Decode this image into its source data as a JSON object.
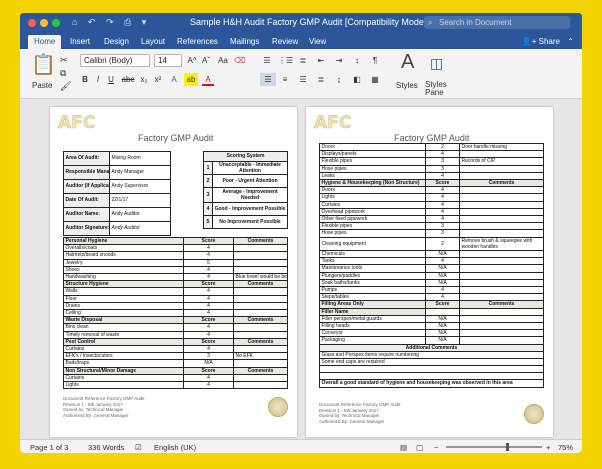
{
  "window": {
    "title": "Sample H&H Audit Factory GMP Audit [Compatibility Mode]",
    "search_placeholder": "Search in Document",
    "quick_access": "⌂ ↶ ↷ ⎙ ▾"
  },
  "tabs": [
    "Home",
    "Insert",
    "Design",
    "Layout",
    "References",
    "Mailings",
    "Review",
    "View"
  ],
  "share_label": "Share",
  "ribbon": {
    "paste": "Paste",
    "font": "Calibri (Body)",
    "size": "14",
    "styles": "Styles",
    "styles_pane": "Styles Pane",
    "bold": "B",
    "italic": "I",
    "underline": "U",
    "strike": "abc",
    "sub": "x₂",
    "sup": "x²",
    "grow": "A^",
    "shrink": "Aˇ",
    "aa": "Aa",
    "font_color": "A",
    "highlight": "ab"
  },
  "page1": {
    "logo": "AFC",
    "title": "Factory GMP Audit",
    "info": [
      [
        "Area Of Audit:",
        "Mixing Room"
      ],
      [
        "Responsible Manager:",
        "Andy Manager"
      ],
      [
        "Auditor (If Applicable):",
        "Andy Supervisor"
      ],
      [
        "Date Of Audit:",
        "22/1/17"
      ],
      [
        "Auditor Name:",
        "Andy Auditor"
      ],
      [
        "Auditor Signature:",
        "Andy Auditor"
      ]
    ],
    "scoring_header": "Scoring System",
    "scoring": [
      [
        "1",
        "Unacceptable - Immediate Attention"
      ],
      [
        "2",
        "Poor - Urgent Attention"
      ],
      [
        "3",
        "Average - Improvement Needed"
      ],
      [
        "4",
        "Good - Improvement Possible"
      ],
      [
        "5",
        "No Improvement Possible"
      ]
    ],
    "rows": [
      {
        "t": "sec",
        "c": [
          "Personal Hygiene",
          "Score",
          "Comments"
        ]
      },
      {
        "c": [
          "Overalls/coats",
          "4",
          ""
        ]
      },
      {
        "c": [
          "Hairnets/beard snoods",
          "4",
          ""
        ]
      },
      {
        "c": [
          "Jewelry",
          "5",
          ""
        ]
      },
      {
        "c": [
          "Shoes",
          "4",
          ""
        ]
      },
      {
        "c": [
          "Handwashing",
          "4",
          "Blue towel would be better"
        ]
      },
      {
        "t": "sec",
        "c": [
          "Structure Hygiene",
          "Score",
          "Comments"
        ]
      },
      {
        "c": [
          "Walls",
          "4",
          ""
        ]
      },
      {
        "c": [
          "Floor",
          "4",
          ""
        ]
      },
      {
        "c": [
          "Drains",
          "4",
          ""
        ]
      },
      {
        "c": [
          "Ceiling",
          "4",
          ""
        ]
      },
      {
        "t": "sec",
        "c": [
          "Waste Disposal",
          "Score",
          "Comments"
        ]
      },
      {
        "c": [
          "Bins clean",
          "4",
          ""
        ]
      },
      {
        "c": [
          "Timely removal of waste",
          "4",
          ""
        ]
      },
      {
        "t": "sec",
        "c": [
          "Pest Control",
          "Score",
          "Comments"
        ]
      },
      {
        "c": [
          "Curtains",
          "4",
          ""
        ]
      },
      {
        "c": [
          "EFK's / Insectocutors",
          "3",
          "No EFK"
        ]
      },
      {
        "c": [
          "Baits/traps",
          "N/A",
          ""
        ]
      },
      {
        "t": "sec",
        "c": [
          "Non Structural/Minor Damage",
          "Score",
          "Comments"
        ]
      },
      {
        "c": [
          "Curtains",
          "4",
          ""
        ]
      },
      {
        "c": [
          "Lights",
          "4",
          ""
        ]
      }
    ],
    "footer": [
      "Document Reference Factory GMP Audit",
      "Revision 1 - 8th January 2017",
      "Owned by: Technical Manager",
      "Authorised By: General Manager"
    ]
  },
  "page2": {
    "logo": "AFC",
    "title": "Factory GMP Audit",
    "rows": [
      {
        "c": [
          "Doors",
          "2",
          "Door handle missing"
        ]
      },
      {
        "c": [
          "Displays/panels",
          "4",
          ""
        ]
      },
      {
        "c": [
          "Flexible pipes",
          "3",
          "Records of CIP"
        ]
      },
      {
        "c": [
          "Hose pipes",
          "3",
          ""
        ]
      },
      {
        "c": [
          "Leaks",
          "4",
          ""
        ]
      },
      {
        "t": "sec",
        "c": [
          "Hygiene & Housekeeping (Non Structure)",
          "Score",
          "Comments"
        ]
      },
      {
        "c": [
          "Doors",
          "4",
          ""
        ]
      },
      {
        "c": [
          "Lights",
          "4",
          ""
        ]
      },
      {
        "c": [
          "Curtains",
          "4",
          ""
        ]
      },
      {
        "c": [
          "Overhead pipework",
          "4",
          ""
        ]
      },
      {
        "c": [
          "Other fixed pipework",
          "4",
          ""
        ]
      },
      {
        "c": [
          "Flexible pipes",
          "3",
          ""
        ]
      },
      {
        "c": [
          "Hose pipes",
          "3",
          ""
        ]
      },
      {
        "t": "tall",
        "c": [
          "Cleaning equipment",
          "2",
          "Remove brush & squeegee with wooden handles"
        ]
      },
      {
        "c": [
          "Chemicals",
          "N/A",
          ""
        ]
      },
      {
        "c": [
          "Tanks",
          "4",
          ""
        ]
      },
      {
        "c": [
          "Maintenance tools",
          "N/A",
          ""
        ]
      },
      {
        "c": [
          "Plungers/paddles",
          "N/A",
          ""
        ]
      },
      {
        "c": [
          "Soak baths/tanks",
          "N/A",
          ""
        ]
      },
      {
        "c": [
          "Pumps",
          "4",
          ""
        ]
      },
      {
        "c": [
          "Steps/tables",
          "4",
          ""
        ]
      },
      {
        "t": "sec",
        "c": [
          "Filling Areas Only",
          "Score",
          "Comments"
        ]
      },
      {
        "t": "sub",
        "c": [
          "Filler Name",
          "",
          ""
        ]
      },
      {
        "c": [
          "Filler perspex/metal guards",
          "N/A",
          ""
        ]
      },
      {
        "c": [
          "Filling heads",
          "N/A",
          ""
        ]
      },
      {
        "c": [
          "Conveyor",
          "N/A",
          ""
        ]
      },
      {
        "c": [
          "Packaging",
          "N/A",
          ""
        ]
      },
      {
        "t": "full",
        "c": [
          "Additional Comments"
        ]
      },
      {
        "t": "note",
        "c": [
          "Glass and Perspex items require numbering"
        ]
      },
      {
        "t": "note",
        "c": [
          "Some end caps are required"
        ]
      },
      {
        "t": "note",
        "c": [
          ""
        ]
      },
      {
        "t": "note",
        "c": [
          ""
        ]
      },
      {
        "t": "note",
        "c": [
          "Overall a good standard of hygiene and housekeeping was observed in this area"
        ]
      }
    ],
    "footer": [
      "Document Reference Factory GMP Audit",
      "Revision 1 - 8th January 2017",
      "Owned by: Technical Manager",
      "Authorised By: General Manager"
    ]
  },
  "status": {
    "page": "Page 1 of 3",
    "words": "336 Words",
    "language": "English (UK)",
    "zoom": "75%"
  }
}
